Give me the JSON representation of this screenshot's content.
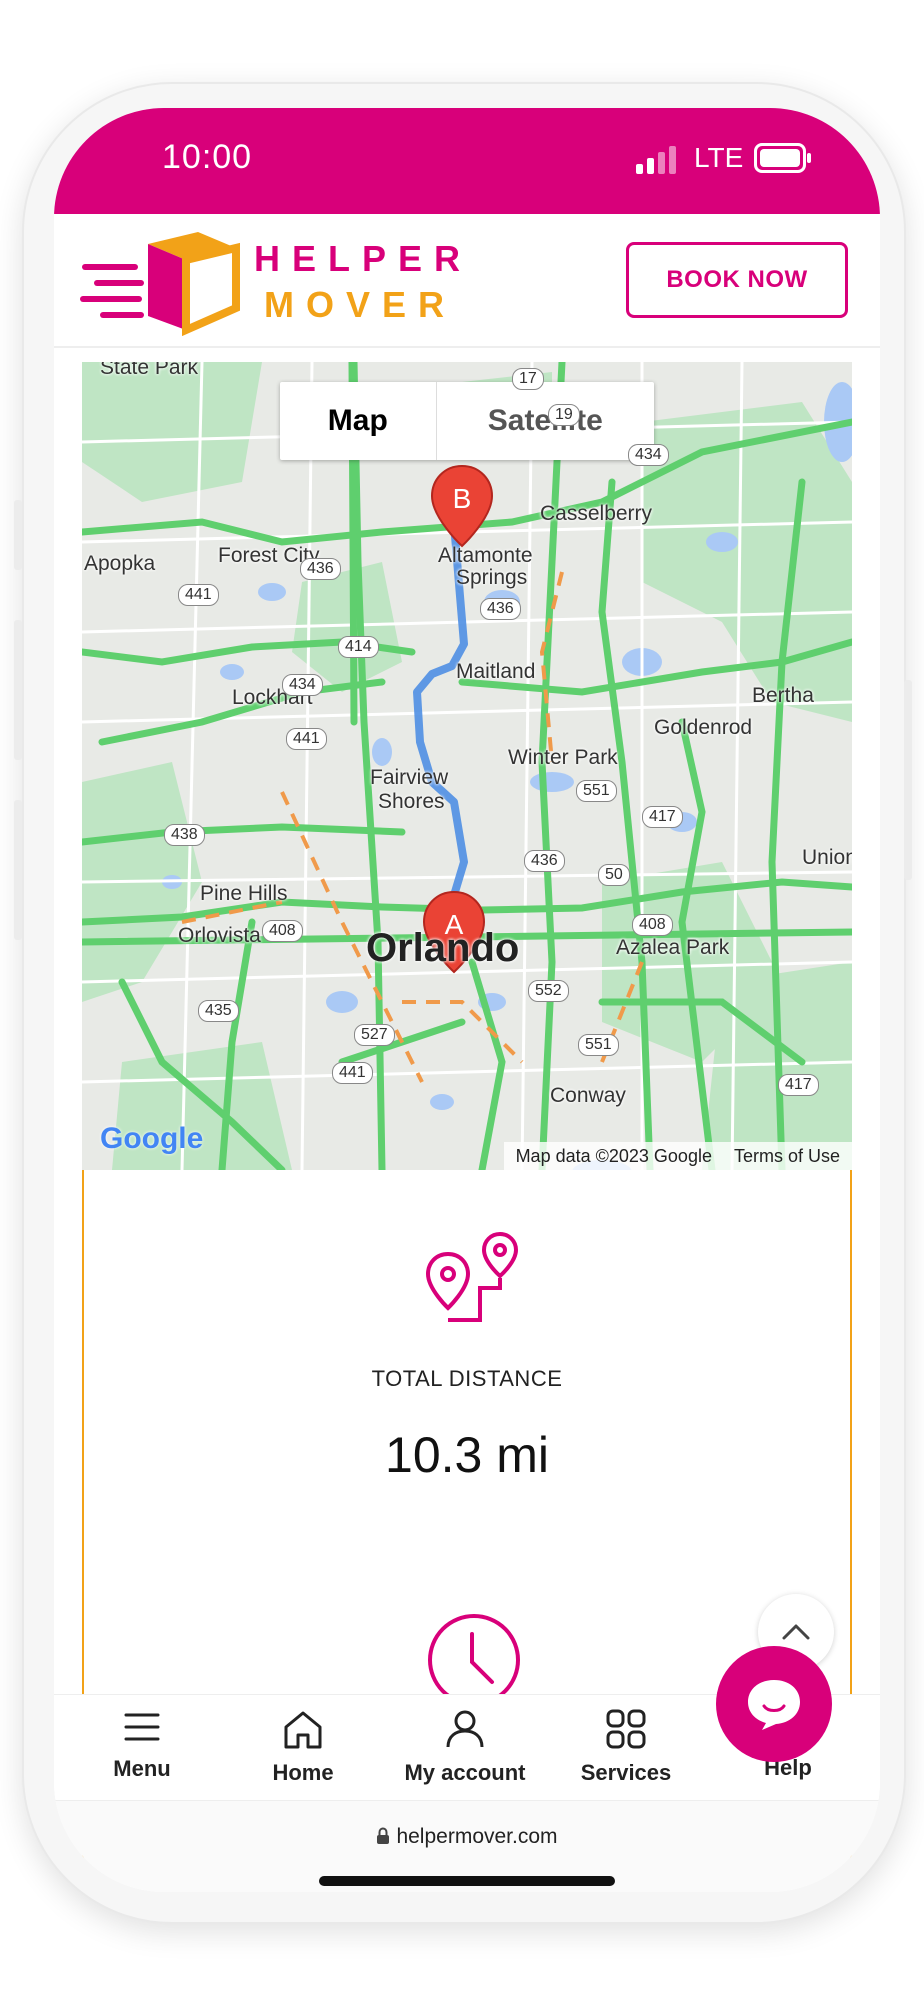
{
  "status": {
    "time": "10:00",
    "network": "LTE"
  },
  "brand": {
    "line1": "HELPER",
    "line2": "MOVER",
    "colors": {
      "primary": "#d8007a",
      "accent": "#f2a218"
    }
  },
  "header": {
    "book_label": "BOOK NOW"
  },
  "map": {
    "toggle": {
      "map": "Map",
      "satellite": "Satellite",
      "selected": "Map"
    },
    "markers": {
      "origin": "A",
      "destination": "B"
    },
    "places": {
      "state_park": "State Park",
      "apopka": "Apopka",
      "forest_city": "Forest City",
      "altamonte1": "Altamonte",
      "altamonte2": "Springs",
      "casselberry": "Casselberry",
      "maitland": "Maitland",
      "lockhart": "Lockhart",
      "bertha": "Bertha",
      "goldenrod": "Goldenrod",
      "winter_park": "Winter Park",
      "fairview1": "Fairview",
      "fairview2": "Shores",
      "pine_hills": "Pine Hills",
      "orlovista": "Orlovista",
      "orlando": "Orlando",
      "azalea_park": "Azalea Park",
      "conway": "Conway",
      "union": "Union"
    },
    "road_shields": [
      "17",
      "19",
      "434",
      "436",
      "441",
      "414",
      "434",
      "436",
      "441",
      "551",
      "417",
      "438",
      "436",
      "50",
      "408",
      "408",
      "552",
      "435",
      "527",
      "441",
      "551",
      "417"
    ],
    "google_logo": "Google",
    "attribution": "Map data ©2023 Google",
    "terms": "Terms of Use"
  },
  "distance": {
    "label": "TOTAL DISTANCE",
    "value": "10.3 mi"
  },
  "nav": {
    "menu": "Menu",
    "home": "Home",
    "account": "My account",
    "services": "Services",
    "help": "Help"
  },
  "browser": {
    "url": "helpermover.com"
  }
}
